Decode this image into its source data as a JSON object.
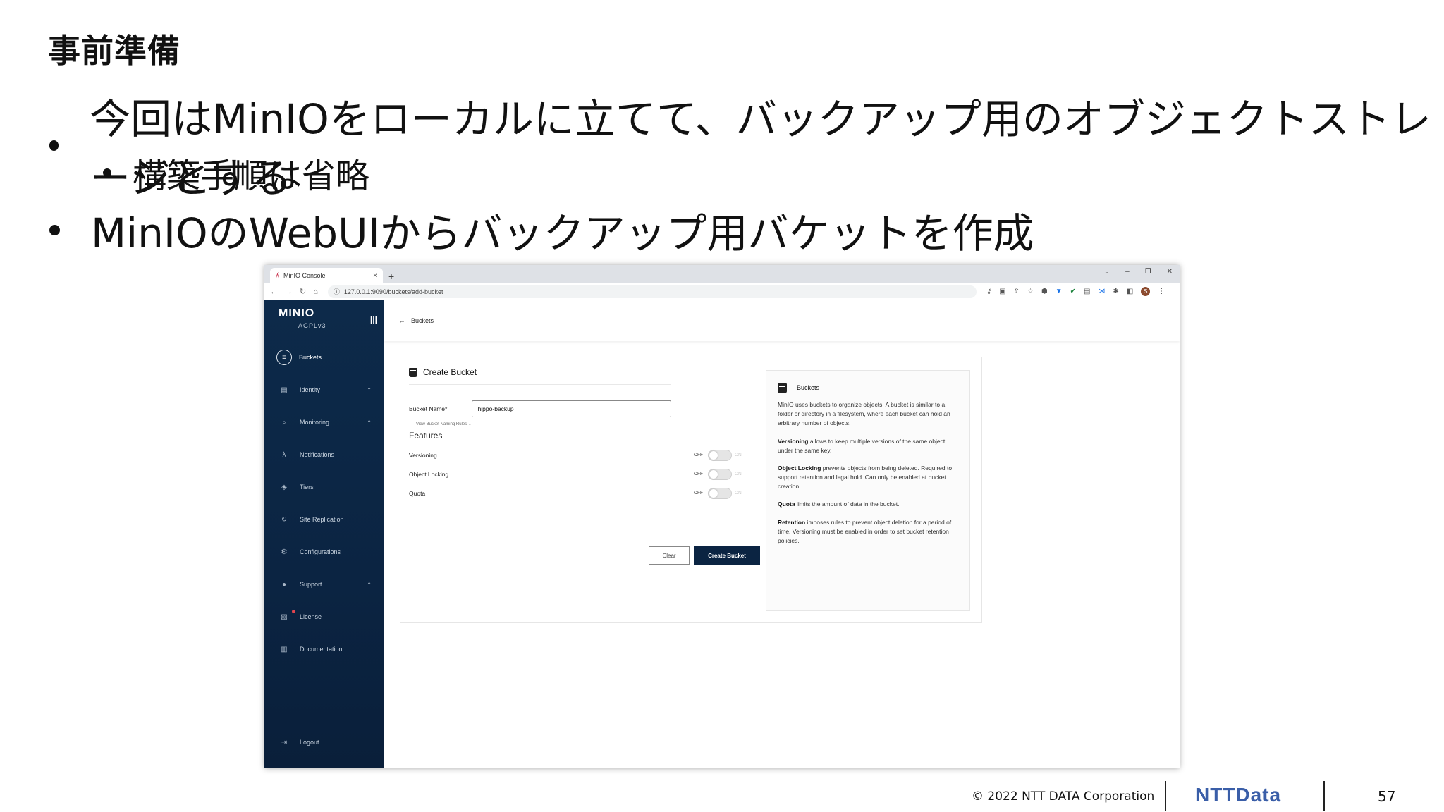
{
  "slide": {
    "title": "事前準備",
    "bullets": [
      "今回はMinIOをローカルに立てて、バックアップ用のオブジェクトストレージとする",
      "構築手順は省略",
      "MinIOのWebUIからバックアップ用バケットを作成"
    ],
    "footer": {
      "copyright": "© 2022 NTT DATA Corporation",
      "logo": "NTTData",
      "page": "57"
    }
  },
  "browser": {
    "tab_label": "MinIO Console",
    "tab_close": "×",
    "new_tab": "+",
    "url": "127.0.0.1:9090/buckets/add-bucket",
    "window_controls": [
      "⌄",
      "–",
      "❐",
      "✕"
    ],
    "nav": [
      "←",
      "→",
      "↻",
      "⌂"
    ]
  },
  "app": {
    "brand": "MINIO",
    "edition": "AGPLv3",
    "nav_items": [
      {
        "label": "Buckets",
        "icon": "bucket-icon"
      },
      {
        "label": "Identity",
        "icon": "identity-icon"
      },
      {
        "label": "Monitoring",
        "icon": "monitoring-icon"
      },
      {
        "label": "Notifications",
        "icon": "lambda-icon"
      },
      {
        "label": "Tiers",
        "icon": "tiers-icon"
      },
      {
        "label": "Site Replication",
        "icon": "replication-icon"
      },
      {
        "label": "Configurations",
        "icon": "gear-icon"
      },
      {
        "label": "Support",
        "icon": "support-icon"
      },
      {
        "label": "License",
        "icon": "license-icon"
      },
      {
        "label": "Documentation",
        "icon": "docs-icon"
      }
    ],
    "logout": "Logout",
    "breadcrumb": "Buckets",
    "form": {
      "title": "Create Bucket",
      "bucket_name_label": "Bucket Name*",
      "bucket_name_value": "hippo-backup",
      "naming_rules": "View Bucket Naming Rules  ⌄",
      "features_title": "Features",
      "toggles": [
        {
          "label": "Versioning",
          "off": "OFF",
          "on": "ON",
          "value": false
        },
        {
          "label": "Object Locking",
          "off": "OFF",
          "on": "ON",
          "value": false
        },
        {
          "label": "Quota",
          "off": "OFF",
          "on": "ON",
          "value": false
        }
      ],
      "clear_label": "Clear",
      "create_label": "Create Bucket"
    },
    "help": {
      "title": "Buckets",
      "intro": "MinIO uses buckets to organize objects. A bucket is similar to a folder or directory in a filesystem, where each bucket can hold an arbitrary number of objects.",
      "versioning_term": "Versioning",
      "versioning_text": " allows to keep multiple versions of the same object under the same key.",
      "locking_term": "Object Locking",
      "locking_text": " prevents objects from being deleted. Required to support retention and legal hold. Can only be enabled at bucket creation.",
      "quota_term": "Quota",
      "quota_text": " limits the amount of data in the bucket.",
      "retention_term": "Retention",
      "retention_text": " imposes rules to prevent object deletion for a period of time. Versioning must be enabled in order to set bucket retention policies."
    }
  },
  "colors": {
    "sidebar": "#0b2442",
    "primary_button": "#0b2442",
    "ntt_logo": "#3a5ea8"
  }
}
